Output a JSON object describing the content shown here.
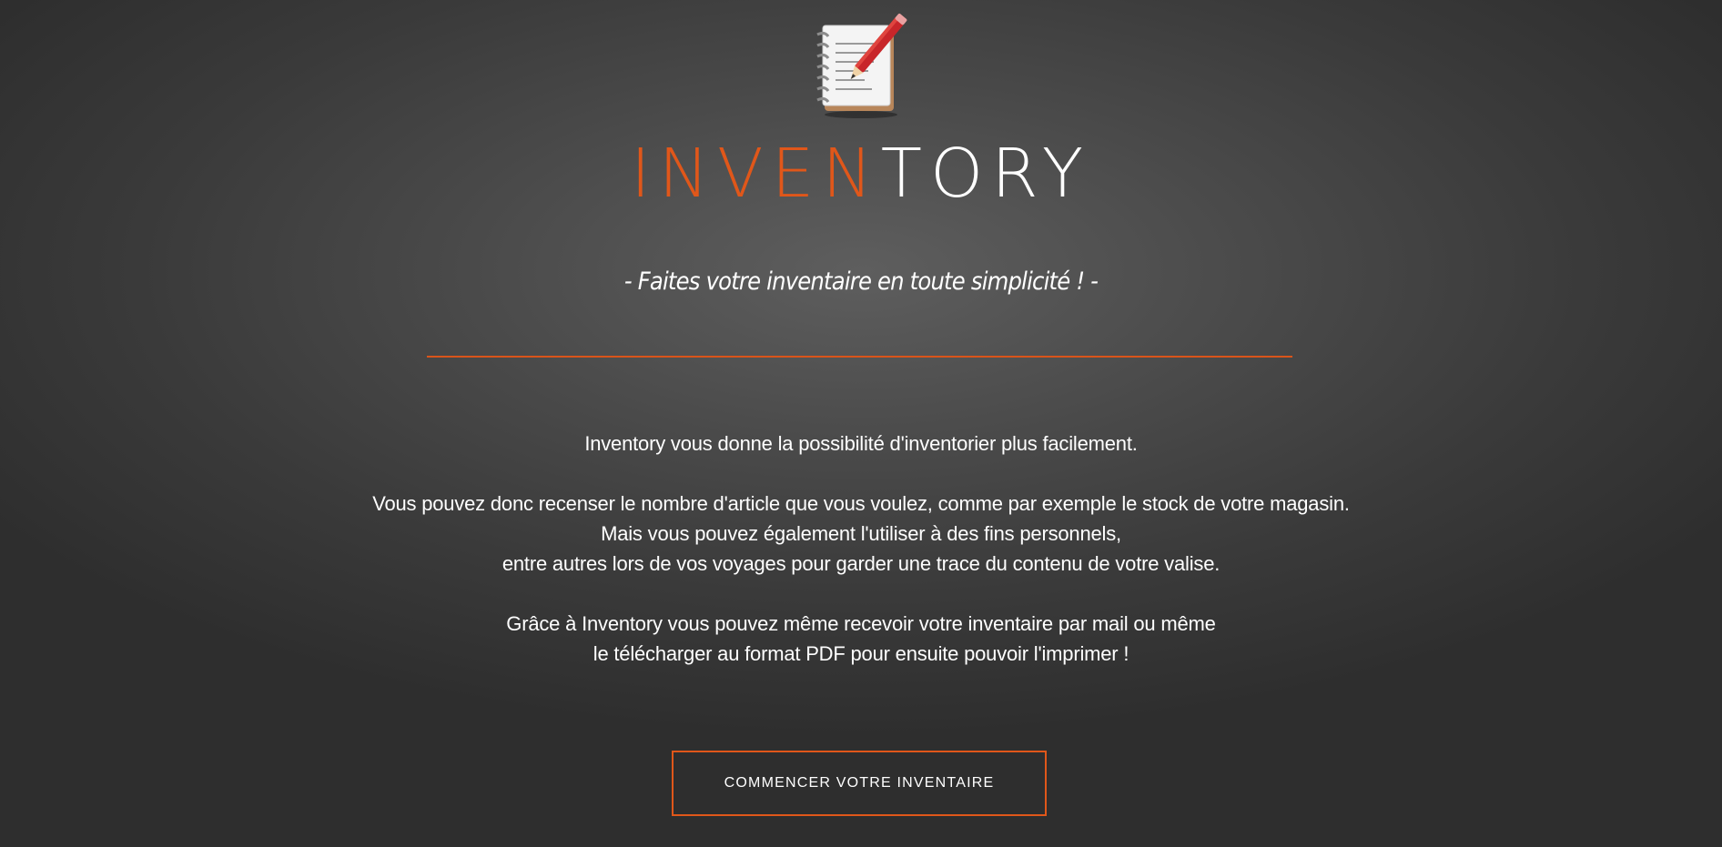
{
  "brand": {
    "part_orange": "INVEN",
    "part_white": "TORY",
    "accent_color": "#e0571a",
    "logo_icon": "notepad-pencil-icon"
  },
  "tagline": "- Faites votre inventaire en toute simplicité ! -",
  "description": {
    "line1": "Inventory vous donne la possibilité d'inventorier plus facilement.",
    "line2": "Vous pouvez donc recenser le nombre d'article que vous voulez, comme par exemple le stock de votre magasin.",
    "line3": "Mais vous pouvez également l'utiliser à des fins personnels,",
    "line4": "entre autres lors de vos voyages pour garder une trace du contenu de votre valise.",
    "line5": "Grâce à Inventory vous pouvez même recevoir votre inventaire par mail ou même",
    "line6": "le télécharger au format PDF pour ensuite pouvoir l'imprimer !"
  },
  "cta": {
    "label": "COMMENCER VOTRE INVENTAIRE"
  }
}
